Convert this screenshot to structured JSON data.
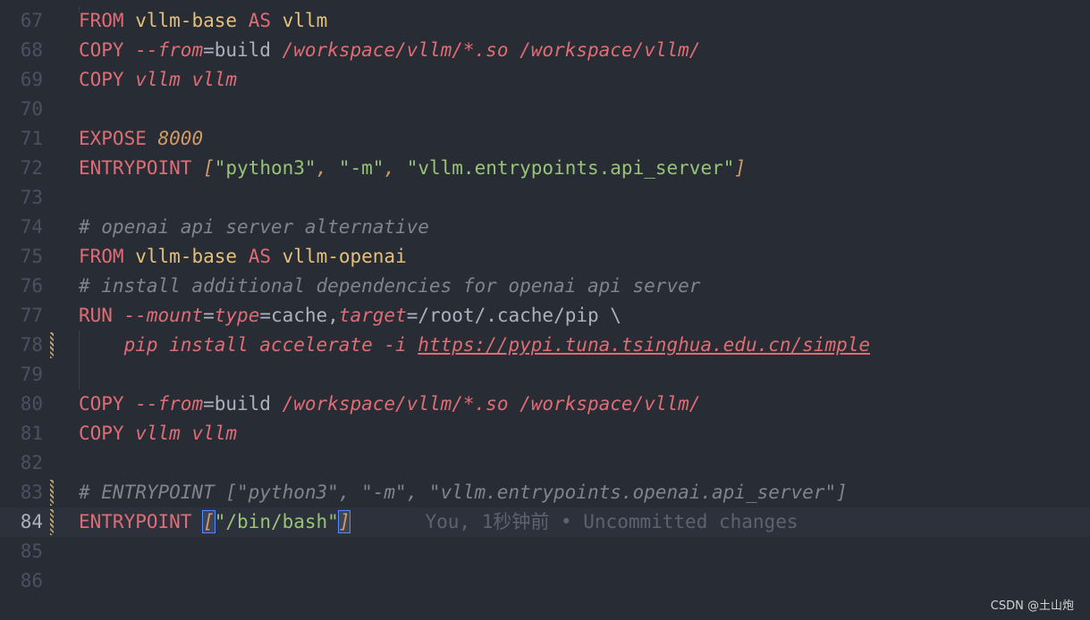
{
  "lines": [
    {
      "n": "67",
      "tokens": [
        [
          "FROM",
          "kwr"
        ],
        [
          " ",
          ""
        ],
        [
          "vllm-base",
          "img"
        ],
        [
          " ",
          ""
        ],
        [
          "AS",
          "kwr"
        ],
        [
          " ",
          ""
        ],
        [
          "vllm",
          "img"
        ]
      ]
    },
    {
      "n": "68",
      "tokens": [
        [
          "COPY",
          "kwr"
        ],
        [
          " ",
          ""
        ],
        [
          "--from",
          "it"
        ],
        [
          "=build ",
          "pun"
        ],
        [
          "/workspace/vllm/*.so /workspace/vllm/",
          "it"
        ]
      ]
    },
    {
      "n": "69",
      "tokens": [
        [
          "COPY",
          "kwr"
        ],
        [
          " ",
          ""
        ],
        [
          "vllm vllm",
          "it"
        ]
      ]
    },
    {
      "n": "70",
      "tokens": []
    },
    {
      "n": "71",
      "tokens": [
        [
          "EXPOSE",
          "kwr"
        ],
        [
          " ",
          ""
        ],
        [
          "8000",
          "num"
        ]
      ]
    },
    {
      "n": "72",
      "tokens": [
        [
          "ENTRYPOINT",
          "kwr"
        ],
        [
          " ",
          ""
        ],
        [
          "[",
          "br"
        ],
        [
          "\"python3\"",
          "str"
        ],
        [
          ", ",
          "br"
        ],
        [
          "\"-m\"",
          "str"
        ],
        [
          ", ",
          "br"
        ],
        [
          "\"vllm.entrypoints.api_server\"",
          "str"
        ],
        [
          "]",
          "br"
        ]
      ]
    },
    {
      "n": "73",
      "tokens": []
    },
    {
      "n": "74",
      "tokens": [
        [
          "# openai api server alternative",
          "cm"
        ]
      ]
    },
    {
      "n": "75",
      "tokens": [
        [
          "FROM",
          "kwr"
        ],
        [
          " ",
          ""
        ],
        [
          "vllm-base",
          "img"
        ],
        [
          " ",
          ""
        ],
        [
          "AS",
          "kwr"
        ],
        [
          " ",
          ""
        ],
        [
          "vllm-openai",
          "img"
        ]
      ]
    },
    {
      "n": "76",
      "tokens": [
        [
          "# install additional dependencies for openai api server",
          "cm"
        ]
      ]
    },
    {
      "n": "77",
      "tokens": [
        [
          "RUN",
          "kwr"
        ],
        [
          " ",
          ""
        ],
        [
          "--mount",
          "it"
        ],
        [
          "=",
          "pun"
        ],
        [
          "type",
          "it"
        ],
        [
          "=cache,",
          "pun"
        ],
        [
          "target",
          "it"
        ],
        [
          "=/root/.cache/pip \\",
          "pun"
        ]
      ]
    },
    {
      "n": "78",
      "mark": true,
      "tokens": [
        [
          "    pip install accelerate -i ",
          "it"
        ],
        [
          "https://pypi.tuna.tsinghua.edu.cn/simple",
          "url"
        ]
      ]
    },
    {
      "n": "79",
      "guide": true,
      "tokens": []
    },
    {
      "n": "80",
      "tokens": [
        [
          "COPY",
          "kwr"
        ],
        [
          " ",
          ""
        ],
        [
          "--from",
          "it"
        ],
        [
          "=build ",
          "pun"
        ],
        [
          "/workspace/vllm/*.so /workspace/vllm/",
          "it"
        ]
      ]
    },
    {
      "n": "81",
      "tokens": [
        [
          "COPY",
          "kwr"
        ],
        [
          " ",
          ""
        ],
        [
          "vllm vllm",
          "it"
        ]
      ]
    },
    {
      "n": "82",
      "tokens": []
    },
    {
      "n": "83",
      "mark": true,
      "tokens": [
        [
          "# ENTRYPOINT [\"python3\", \"-m\", \"vllm.entrypoints.openai.api_server\"]",
          "cm"
        ]
      ]
    },
    {
      "n": "84",
      "mark": true,
      "active": true,
      "tokens": [
        [
          "ENTRYPOINT",
          "kwr"
        ],
        [
          " ",
          ""
        ],
        [
          "[",
          "br cursor-br"
        ],
        [
          "\"/bin/bash\"",
          "str"
        ],
        [
          "]",
          "br cursor-br"
        ]
      ],
      "blame": "You, 1秒钟前 • Uncommitted changes"
    },
    {
      "n": "85",
      "tokens": []
    },
    {
      "n": "86",
      "tokens": []
    }
  ],
  "watermark": "CSDN @土山炮"
}
